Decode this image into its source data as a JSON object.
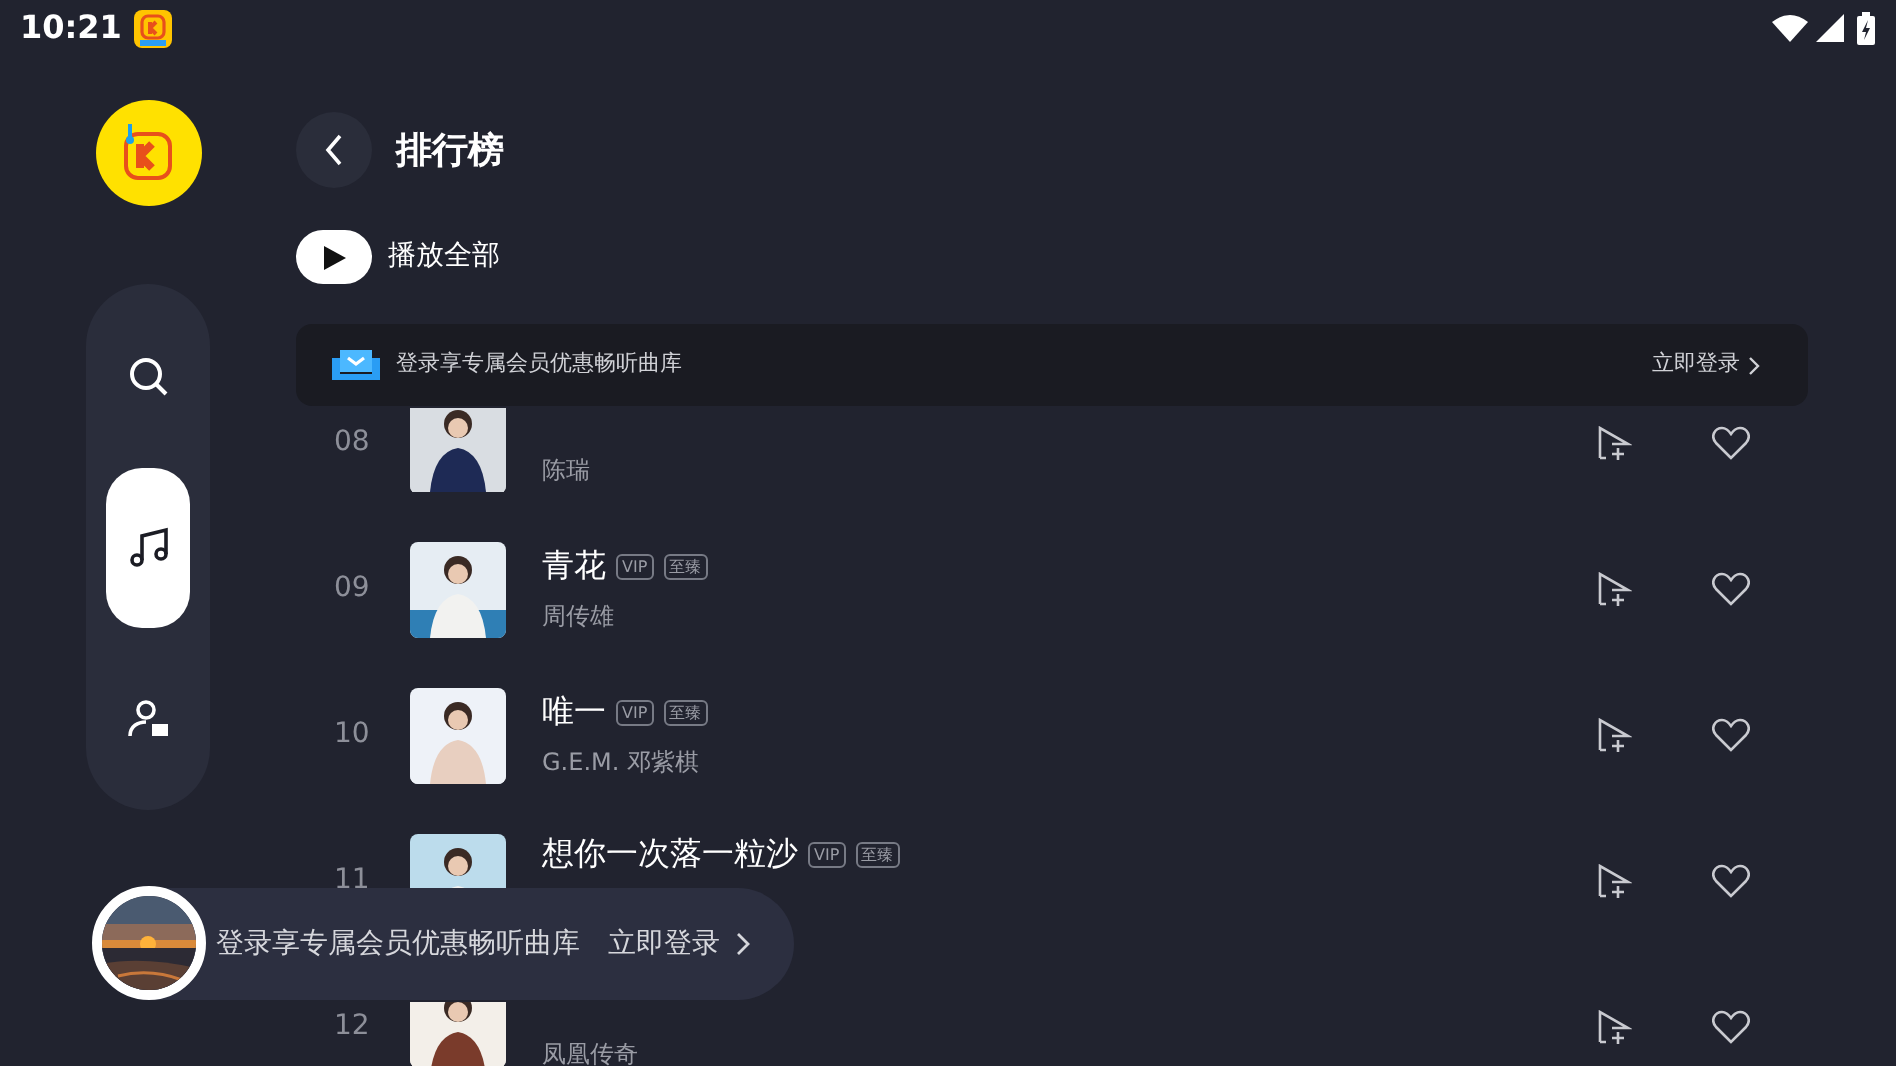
{
  "status_bar": {
    "time": "10:21"
  },
  "sidebar": {
    "items": [
      {
        "kind": "search",
        "selected": false
      },
      {
        "kind": "music",
        "selected": true
      },
      {
        "kind": "profile",
        "selected": false
      }
    ]
  },
  "header": {
    "title": "排行榜"
  },
  "play_all": {
    "label": "播放全部"
  },
  "login_banner": {
    "text": "登录享专属会员优惠畅听曲库",
    "action": "立即登录"
  },
  "songs": [
    {
      "rank": "08",
      "artist": "陈瑞"
    },
    {
      "rank": "09",
      "title": "青花",
      "badges": [
        "VIP",
        "至臻"
      ],
      "artist": "周传雄"
    },
    {
      "rank": "10",
      "title": "唯一",
      "badges": [
        "VIP",
        "至臻"
      ],
      "artist": "G.E.M. 邓紫棋"
    },
    {
      "rank": "11",
      "title": "想你一次落一粒沙",
      "badges": [
        "VIP",
        "至臻"
      ]
    },
    {
      "rank": "12",
      "artist": "凤凰传奇"
    }
  ],
  "mini_player": {
    "text": "登录享专属会员优惠畅听曲库",
    "action": "立即登录"
  }
}
